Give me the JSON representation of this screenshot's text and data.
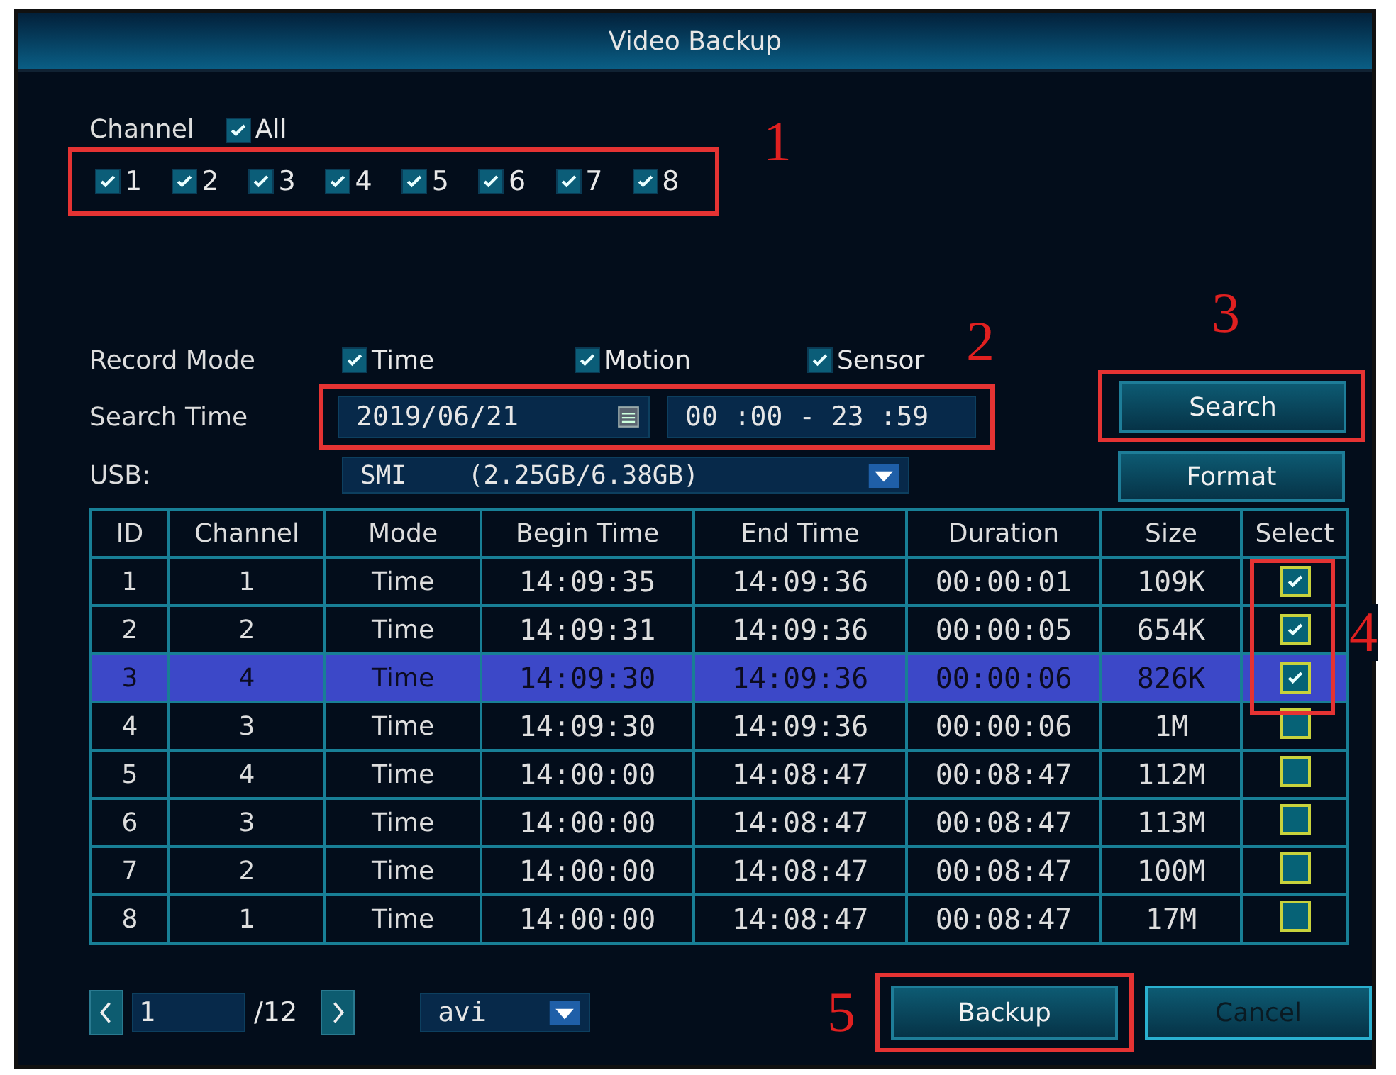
{
  "window": {
    "title": "Video Backup"
  },
  "channel": {
    "label": "Channel",
    "all": {
      "label": "All",
      "checked": true
    },
    "items": [
      {
        "label": "1",
        "checked": true
      },
      {
        "label": "2",
        "checked": true
      },
      {
        "label": "3",
        "checked": true
      },
      {
        "label": "4",
        "checked": true
      },
      {
        "label": "5",
        "checked": true
      },
      {
        "label": "6",
        "checked": true
      },
      {
        "label": "7",
        "checked": true
      },
      {
        "label": "8",
        "checked": true
      }
    ]
  },
  "record_mode": {
    "label": "Record Mode",
    "options": [
      {
        "label": "Time",
        "checked": true
      },
      {
        "label": "Motion",
        "checked": true
      },
      {
        "label": "Sensor",
        "checked": true
      }
    ]
  },
  "search_time": {
    "label": "Search Time",
    "date": "2019/06/21",
    "time_range": "00 :00 - 23 :59"
  },
  "usb": {
    "label": "USB:",
    "value": "SMI    (2.25GB/6.38GB)"
  },
  "buttons": {
    "search": "Search",
    "format": "Format"
  },
  "table": {
    "columns": [
      "ID",
      "Channel",
      "Mode",
      "Begin Time",
      "End Time",
      "Duration",
      "Size",
      "Select"
    ],
    "rows": [
      {
        "cells": [
          "1",
          "1",
          "Time",
          "14:09:35",
          "14:09:36",
          "00:00:01",
          "109K"
        ],
        "selected": false,
        "checked": true
      },
      {
        "cells": [
          "2",
          "2",
          "Time",
          "14:09:31",
          "14:09:36",
          "00:00:05",
          "654K"
        ],
        "selected": false,
        "checked": true
      },
      {
        "cells": [
          "3",
          "4",
          "Time",
          "14:09:30",
          "14:09:36",
          "00:00:06",
          "826K"
        ],
        "selected": true,
        "checked": true
      },
      {
        "cells": [
          "4",
          "3",
          "Time",
          "14:09:30",
          "14:09:36",
          "00:00:06",
          "1M"
        ],
        "selected": false,
        "checked": false
      },
      {
        "cells": [
          "5",
          "4",
          "Time",
          "14:00:00",
          "14:08:47",
          "00:08:47",
          "112M"
        ],
        "selected": false,
        "checked": false
      },
      {
        "cells": [
          "6",
          "3",
          "Time",
          "14:00:00",
          "14:08:47",
          "00:08:47",
          "113M"
        ],
        "selected": false,
        "checked": false
      },
      {
        "cells": [
          "7",
          "2",
          "Time",
          "14:00:00",
          "14:08:47",
          "00:08:47",
          "100M"
        ],
        "selected": false,
        "checked": false
      },
      {
        "cells": [
          "8",
          "1",
          "Time",
          "14:00:00",
          "14:08:47",
          "00:08:47",
          "17M"
        ],
        "selected": false,
        "checked": false
      }
    ]
  },
  "pagination": {
    "page": "1",
    "total": "/12"
  },
  "file_format": "avi",
  "actions": {
    "backup": "Backup",
    "cancel": "Cancel"
  },
  "callouts": [
    {
      "label": "1"
    },
    {
      "label": "2"
    },
    {
      "label": "3"
    },
    {
      "label": "4"
    },
    {
      "label": "5"
    }
  ]
}
